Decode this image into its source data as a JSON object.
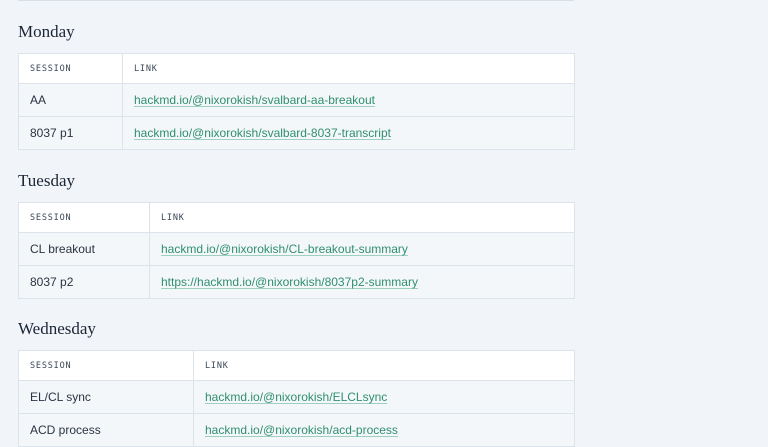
{
  "days": [
    {
      "heading": "Monday",
      "columns": {
        "session": "SESSION",
        "link": "LINK"
      },
      "rows": [
        {
          "session": "AA",
          "link": "hackmd.io/@nixorokish/svalbard-aa-breakout"
        },
        {
          "session": "8037 p1",
          "link": "hackmd.io/@nixorokish/svalbard-8037-transcript"
        }
      ]
    },
    {
      "heading": "Tuesday",
      "columns": {
        "session": "SESSION",
        "link": "LINK"
      },
      "rows": [
        {
          "session": "CL breakout",
          "link": "hackmd.io/@nixorokish/CL-breakout-summary"
        },
        {
          "session": "8037 p2",
          "link": "https://hackmd.io/@nixorokish/8037p2-summary"
        }
      ]
    },
    {
      "heading": "Wednesday",
      "columns": {
        "session": "SESSION",
        "link": "LINK"
      },
      "rows": [
        {
          "session": "EL/CL sync",
          "link": "hackmd.io/@nixorokish/ELCLsync"
        },
        {
          "session": "ACD process",
          "link": "hackmd.io/@nixorokish/acd-process"
        }
      ]
    }
  ]
}
